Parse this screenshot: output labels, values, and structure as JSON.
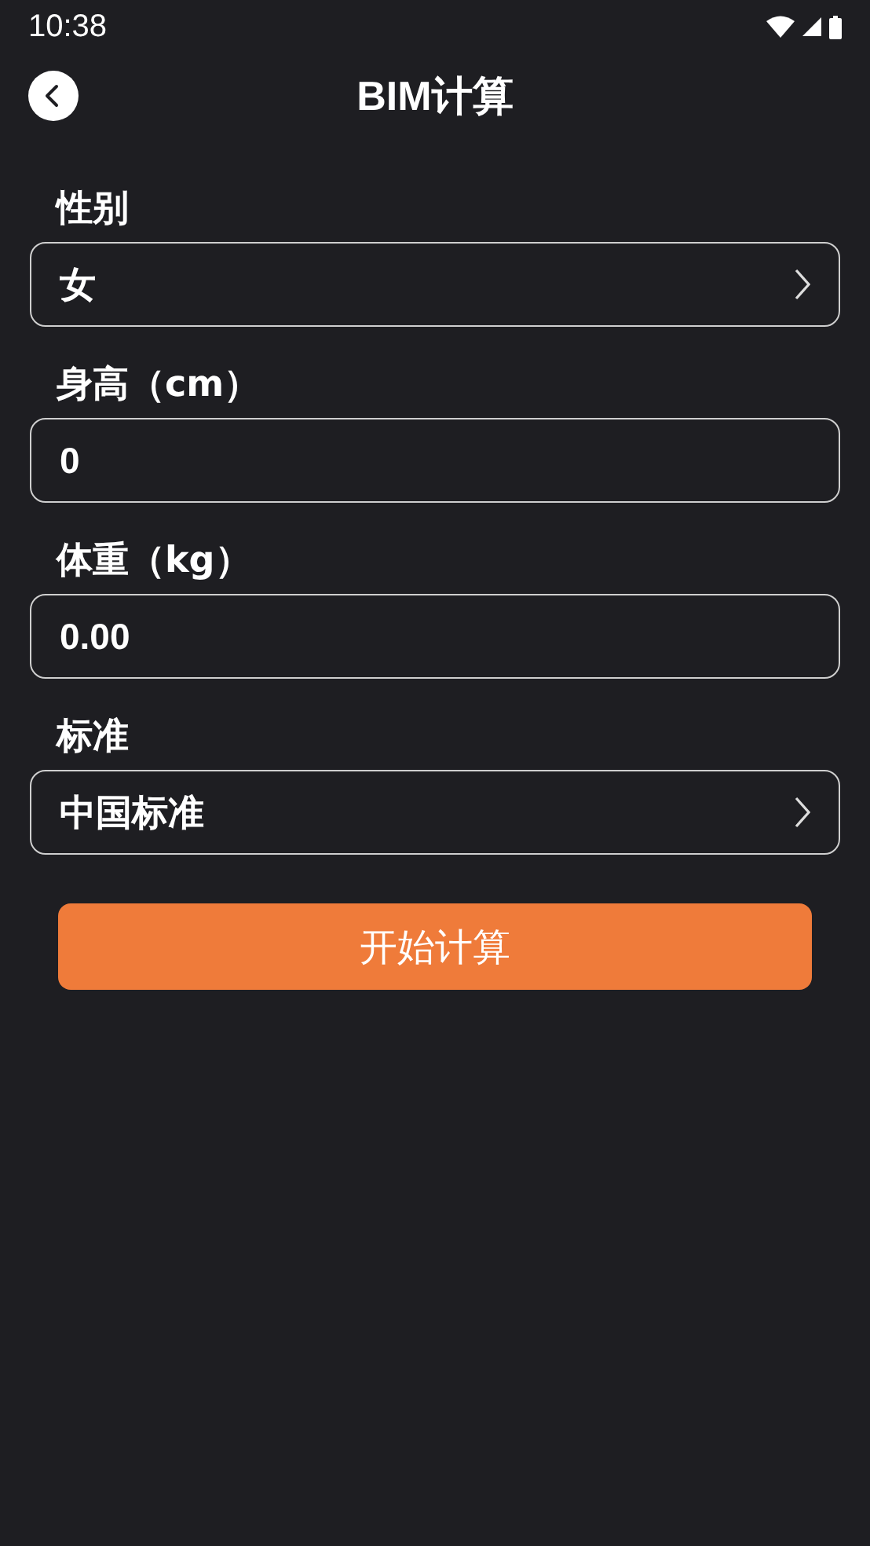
{
  "status_bar": {
    "time": "10:38"
  },
  "header": {
    "title": "BIM计算"
  },
  "fields": [
    {
      "label": "性别",
      "kind": "select",
      "value": "女"
    },
    {
      "label": "身高（cm）",
      "kind": "input",
      "value": "0"
    },
    {
      "label": "体重（kg）",
      "kind": "input",
      "value": "0.00"
    },
    {
      "label": "标准",
      "kind": "select",
      "value": "中国标准"
    }
  ],
  "submit_button": {
    "label": "开始计算"
  }
}
